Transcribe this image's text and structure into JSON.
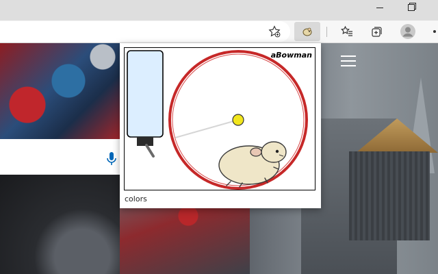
{
  "window": {
    "controls": [
      {
        "name": "minimize",
        "glyph": "—"
      },
      {
        "name": "maximize",
        "glyph": "❐"
      }
    ]
  },
  "toolbar": {
    "icons": [
      "add-favorite-icon",
      "extension-hamster-icon",
      "favorites-icon",
      "collections-icon",
      "profile-avatar-icon",
      "more-icon"
    ]
  },
  "popup": {
    "brand": "aBowman",
    "colors_link": "colors",
    "wheel_color": "#c62828",
    "bottle_color": "#dceeff",
    "ball_color": "#f2e61d",
    "hamster_color": "#efe6c8"
  },
  "page": {
    "accent": "#0067b8"
  }
}
